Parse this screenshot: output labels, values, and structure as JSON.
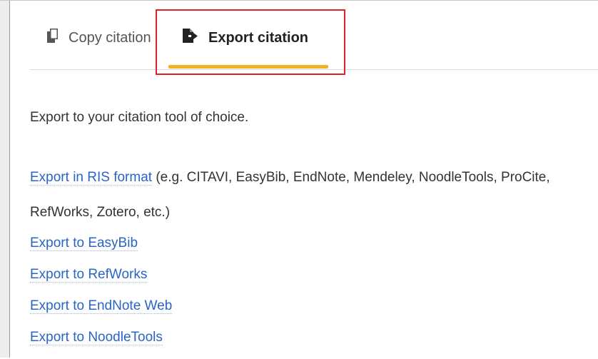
{
  "tabs": {
    "copy_label": "Copy citation",
    "export_label": "Export citation",
    "active": "export",
    "accent_color": "#f0b323",
    "highlight_color": "#e01f26",
    "copy_icon": "copy-icon",
    "export_icon": "file-export-icon"
  },
  "content": {
    "intro": "Export to your citation tool of choice.",
    "ris_link": "Export in RIS format",
    "ris_desc_1": " (e.g. CITAVI, EasyBib, EndNote, Mendeley, NoodleTools, ProCite,",
    "ris_desc_2": "RefWorks, Zotero, etc.)",
    "links": [
      "Export to EasyBib",
      "Export to RefWorks",
      "Export to EndNote Web",
      "Export to NoodleTools"
    ],
    "link_color": "#2a64c5"
  }
}
